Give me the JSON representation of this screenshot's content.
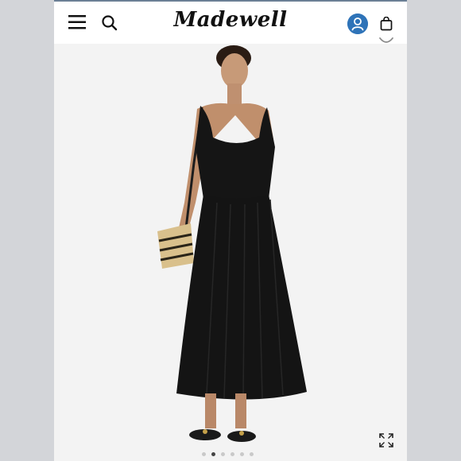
{
  "header": {
    "brand": "Madewell",
    "icons": {
      "menu": "hamburger-menu-icon",
      "search": "search-icon",
      "account": "account-icon",
      "bag": "shopping-bag-icon",
      "favorite": "heart-icon"
    },
    "account_color": "#2e73b8"
  },
  "product": {
    "image": "model-wearing-black-sleeveless-midi-dress",
    "gallery": {
      "total": 6,
      "current_index": 2
    },
    "expand_icon": "expand-icon"
  }
}
